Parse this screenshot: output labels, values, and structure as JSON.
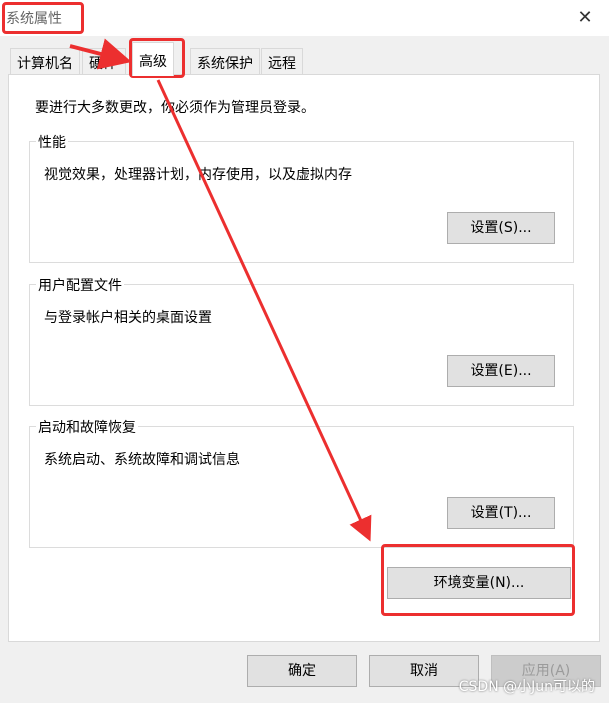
{
  "window": {
    "title": "系统属性",
    "close_icon": "close-icon"
  },
  "tabs": [
    {
      "label": "计算机名",
      "active": false
    },
    {
      "label": "硬件",
      "active": false
    },
    {
      "label": "高级",
      "active": true
    },
    {
      "label": "系统保护",
      "active": false
    },
    {
      "label": "远程",
      "active": false
    }
  ],
  "advanced": {
    "notice": "要进行大多数更改，你必须作为管理员登录。",
    "performance": {
      "title": "性能",
      "description": "视觉效果，处理器计划，内存使用，以及虚拟内存",
      "button": "设置(S)..."
    },
    "user_profiles": {
      "title": "用户配置文件",
      "description": "与登录帐户相关的桌面设置",
      "button": "设置(E)..."
    },
    "startup_recovery": {
      "title": "启动和故障恢复",
      "description": "系统启动、系统故障和调试信息",
      "button": "设置(T)..."
    },
    "env_button": "环境变量(N)..."
  },
  "footer": {
    "ok": "确定",
    "cancel": "取消",
    "apply": "应用(A)"
  },
  "watermark": "CSDN @小Jun可以的",
  "colors": {
    "annotation_red": "#ec2f2f",
    "dialog_bg": "#f0f0f0",
    "panel_bg": "#ffffff",
    "button_bg": "#e1e1e1"
  }
}
